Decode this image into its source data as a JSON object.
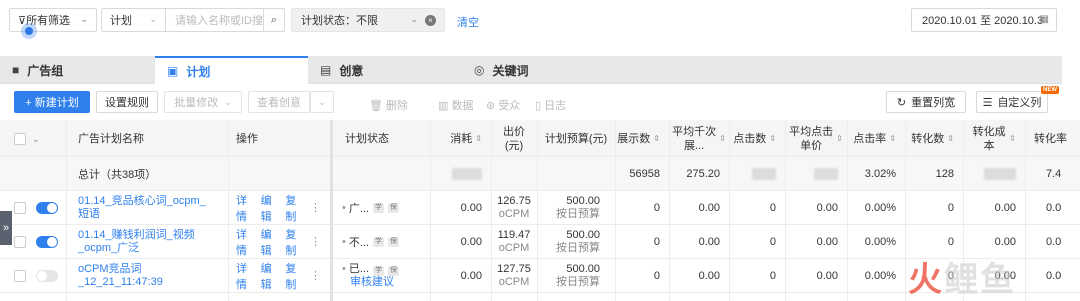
{
  "filters": {
    "all_filter": "所有筛选",
    "plan_select": "计划",
    "search_placeholder": "请输入名称或ID搜",
    "status_chip": "计划状态：不限",
    "clear": "清空",
    "date_range": "2020.10.01 至 2020.10.3"
  },
  "tabs": [
    {
      "label": "广告组",
      "icon": "folder-icon"
    },
    {
      "label": "计划",
      "icon": "calendar-icon"
    },
    {
      "label": "创意",
      "icon": "film-icon"
    },
    {
      "label": "关键词",
      "icon": "target-icon"
    }
  ],
  "toolbar": {
    "new_plan": "+ 新建计划",
    "set_rule": "设置规则",
    "batch_edit": "批量修改",
    "view_creative": "查看创意",
    "delete": "删除",
    "data": "数据",
    "audience": "受众",
    "log": "日志",
    "reset_cols": "重置列宽",
    "custom_cols": "自定义列",
    "new_badge": "NEW"
  },
  "columns": {
    "name": "广告计划名称",
    "ops": "操作",
    "status": "计划状态",
    "cost": "消耗",
    "bid": "出价(元)",
    "budget": "计划预算(元)",
    "impressions": "展示数",
    "cpm": "平均千次展...",
    "clicks": "点击数",
    "cpc": "平均点击单价",
    "ctr": "点击率",
    "conversions": "转化数",
    "cpa": "转化成本",
    "cvr": "转化率"
  },
  "total": {
    "label": "总计（共38项）",
    "impressions": "56958",
    "cpm": "275.20",
    "ctr": "3.02%",
    "conversions": "128",
    "cvr": "7.4"
  },
  "rows": [
    {
      "name": "01.14_竞品核心词_ocpm_短语",
      "ops": [
        "详情",
        "编辑",
        "复制"
      ],
      "status": "广...",
      "review": "",
      "cost": "0.00",
      "bid": "126.75",
      "bid_type": "oCPM",
      "budget": "500.00",
      "budget_type": "按日预算",
      "impressions": "0",
      "cpm": "0.00",
      "clicks": "0",
      "cpc": "0.00",
      "ctr": "0.00%",
      "conversions": "0",
      "cpa": "0.00",
      "cvr": "0.0",
      "enabled": true
    },
    {
      "name": "01.14_赚钱利润词_视频_ocpm_广泛",
      "ops": [
        "详情",
        "编辑",
        "复制"
      ],
      "status": "不...",
      "review": "",
      "cost": "0.00",
      "bid": "119.47",
      "bid_type": "oCPM",
      "budget": "500.00",
      "budget_type": "按日预算",
      "impressions": "0",
      "cpm": "0.00",
      "clicks": "0",
      "cpc": "0.00",
      "ctr": "0.00%",
      "conversions": "0",
      "cpa": "0.00",
      "cvr": "0.0",
      "enabled": true
    },
    {
      "name": "oCPM竞品词_12_21_11:47:39",
      "ops": [
        "详情",
        "编辑",
        "复制"
      ],
      "status": "已...",
      "review": "审核建议",
      "cost": "0.00",
      "bid": "127.75",
      "bid_type": "oCPM",
      "budget": "500.00",
      "budget_type": "按日预算",
      "impressions": "0",
      "cpm": "0.00",
      "clicks": "0",
      "cpc": "0.00",
      "ctr": "0.00%",
      "conversions": "0",
      "cpa": "0.00",
      "cvr": "0.0",
      "enabled": false
    }
  ],
  "status_tags": [
    "学",
    "保"
  ],
  "watermark": {
    "red": "火",
    "grey": "鲤鱼"
  },
  "side_handle": "»"
}
